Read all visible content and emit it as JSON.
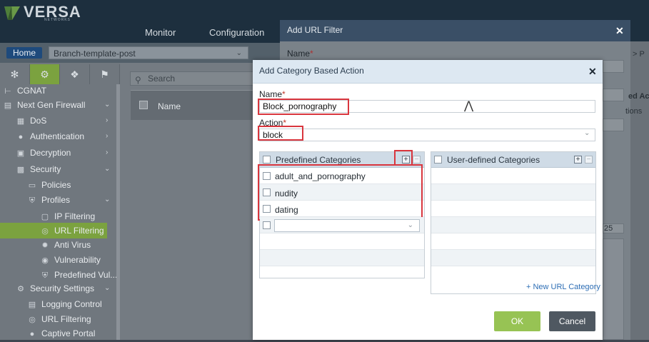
{
  "app": {
    "logo_text": "VERSA",
    "logo_sub": "NETWORKS",
    "nav_monitor": "Monitor",
    "nav_configuration": "Configuration"
  },
  "toolbar": {
    "home_label": "Home",
    "branch_value": "Branch-template-post"
  },
  "sidebar": {
    "items": [
      {
        "label": "CGNAT",
        "icon": "network-icon"
      },
      {
        "label": "Next Gen Firewall",
        "icon": "firewall-icon"
      },
      {
        "label": "DoS",
        "icon": "dos-icon"
      },
      {
        "label": "Authentication",
        "icon": "user-icon"
      },
      {
        "label": "Decryption",
        "icon": "lock-icon"
      },
      {
        "label": "Security",
        "icon": "wall-icon"
      },
      {
        "label": "Policies",
        "icon": "document-icon"
      },
      {
        "label": "Profiles",
        "icon": "shield-icon"
      },
      {
        "label": "IP Filtering",
        "icon": "monitor-icon"
      },
      {
        "label": "URL Filtering",
        "icon": "globe-icon"
      },
      {
        "label": "Anti Virus",
        "icon": "bug-icon"
      },
      {
        "label": "Vulnerability",
        "icon": "target-icon"
      },
      {
        "label": "Predefined Vul...",
        "icon": "shield-icon"
      },
      {
        "label": "Security Settings",
        "icon": "gear-icon"
      },
      {
        "label": "Logging Control",
        "icon": "log-icon"
      },
      {
        "label": "URL Filtering",
        "icon": "globe-icon"
      },
      {
        "label": "Captive Portal",
        "icon": "user-icon"
      }
    ]
  },
  "list": {
    "search_placeholder": "Search",
    "col_name": "Name"
  },
  "url_filter_dialog": {
    "title": "Add URL Filter",
    "name_label": "Name",
    "side_text_1": "> P",
    "side_text_2": "ed Ac",
    "side_text_3": "tions",
    "side_text_4": "25"
  },
  "modal": {
    "title": "Add Category Based Action",
    "name_label": "Name",
    "name_value": "Block_pornography",
    "action_label": "Action",
    "action_value": "block",
    "predefined_header": "Predefined Categories",
    "predefined_rows": [
      "adult_and_pornography",
      "nudity",
      "dating"
    ],
    "userdefined_header": "User-defined Categories",
    "new_url_category": "+ New URL Category",
    "ok_label": "OK",
    "cancel_label": "Cancel"
  },
  "colors": {
    "accent_green": "#7ba23f",
    "highlight_red": "#d9363e",
    "ok_green": "#97c354"
  }
}
